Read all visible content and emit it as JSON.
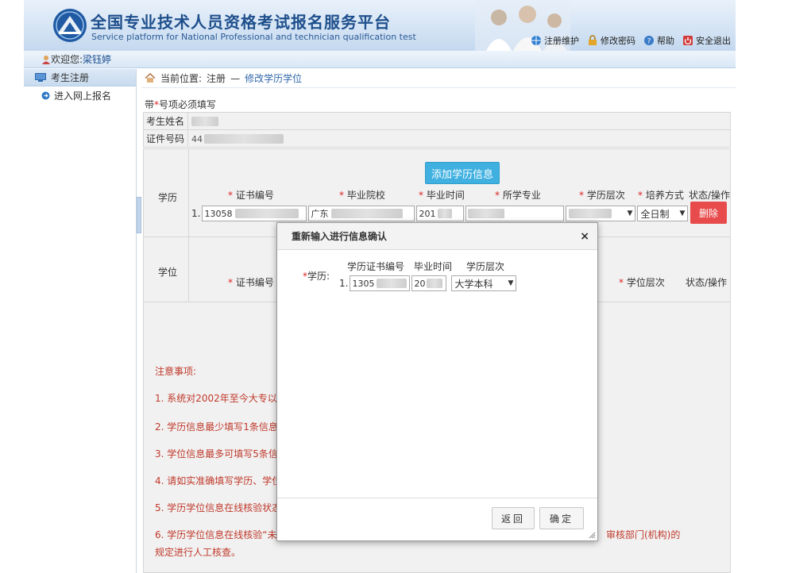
{
  "header": {
    "title_cn": "全国专业技术人员资格考试报名服务平台",
    "title_en": "Service platform for National Professional and technician qualification test",
    "links": [
      {
        "label": "注册维护",
        "icon": "globe-icon"
      },
      {
        "label": "修改密码",
        "icon": "lock-icon"
      },
      {
        "label": "帮助",
        "icon": "help-icon"
      },
      {
        "label": "安全退出",
        "icon": "power-icon"
      }
    ]
  },
  "welcome": {
    "prefix": "欢迎您:",
    "user": "梁钰婷"
  },
  "sidebar": {
    "section": "考生注册",
    "items": [
      {
        "label": "进入网上报名"
      }
    ]
  },
  "breadcrumb": {
    "prefix": "当前位置:",
    "path1": "注册",
    "sep": "—",
    "current": "修改学历学位"
  },
  "form": {
    "required_note_pre": "带",
    "required_star": "*",
    "required_note_post": "号项必须填写",
    "name_label": "考生姓名",
    "id_label": "证件号码",
    "id_value_visible": "44",
    "education_label": "学历",
    "add_button": "添加学历信息",
    "edu_columns": [
      "证书编号",
      "毕业院校",
      "毕业时间",
      "所学专业",
      "学历层次",
      "培养方式"
    ],
    "edu_status_col": "状态/操作",
    "edu_row": {
      "index": "1.",
      "cert_no_visible": "13058",
      "school_visible": "广东",
      "grad_time_visible": "201",
      "mode": "全日制"
    },
    "delete_button": "删除",
    "degree_label": "学位",
    "deg_columns": [
      "证书编号",
      "学位层次"
    ],
    "deg_status_col": "状态/操作"
  },
  "notes": {
    "title": "注意事项:",
    "items": [
      "1. 系统对2002年至今大专以上",
      "2. 学历信息最少填写1条信息,",
      "3. 学位信息最多可填写5条信息",
      "4. 请如实准确填写学历、学位",
      "5. 学历学位信息在线核验状态",
      "6. 学历学位信息在线核验“未"
    ],
    "item6_tail": "审核部门(机构)的",
    "item6_line2": "规定进行人工核查。"
  },
  "modal": {
    "title": "重新输入进行信息确认",
    "close": "×",
    "edu_label": "学历:",
    "star": "*",
    "columns": [
      "学历证书编号",
      "毕业时间",
      "学历层次"
    ],
    "row_index": "1.",
    "cert_visible": "1305",
    "time_visible": "20",
    "level": "大学本科",
    "back_button": "返回",
    "confirm_button": "确定"
  }
}
